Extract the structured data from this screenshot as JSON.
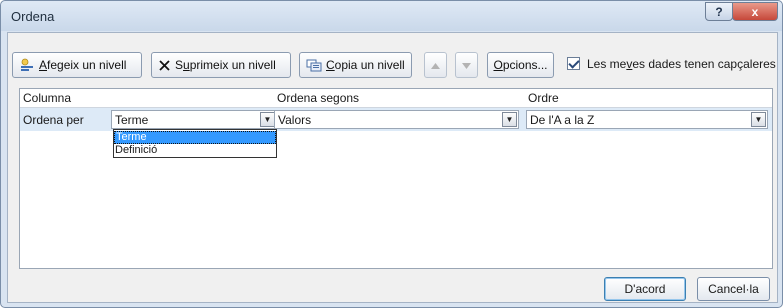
{
  "window": {
    "title": "Ordena",
    "help_label": "?",
    "close_label": "x"
  },
  "toolbar": {
    "add_level": {
      "pre": "",
      "u": "A",
      "post": "fegeix un nivell"
    },
    "delete_level": {
      "pre": "S",
      "u": "u",
      "post": "primeix un nivell"
    },
    "copy_level": {
      "pre": "",
      "u": "C",
      "post": "opia un nivell"
    },
    "options": {
      "pre": "",
      "u": "O",
      "post": "pcions..."
    },
    "move_up_icon": "triangle-up",
    "move_down_icon": "triangle-down",
    "headers_checkbox": {
      "checked": true,
      "pre": "Les me",
      "u": "v",
      "post": "es dades tenen capçaleres"
    }
  },
  "grid": {
    "headers": {
      "column": "Columna",
      "sort_on": "Ordena segons",
      "order": "Ordre"
    },
    "row": {
      "label": "Ordena per",
      "column_value": "Terme",
      "sort_on_value": "Valors",
      "order_value": "De l'A a la Z"
    },
    "dropdown_options": [
      "Terme",
      "Definició"
    ]
  },
  "footer": {
    "ok": "D'acord",
    "cancel": "Cancel·la"
  },
  "colors": {
    "title_bar": "#c9d8ea",
    "close_button": "#c6483a",
    "selection": "#3399ff",
    "row_highlight": "#ddeaf7"
  }
}
